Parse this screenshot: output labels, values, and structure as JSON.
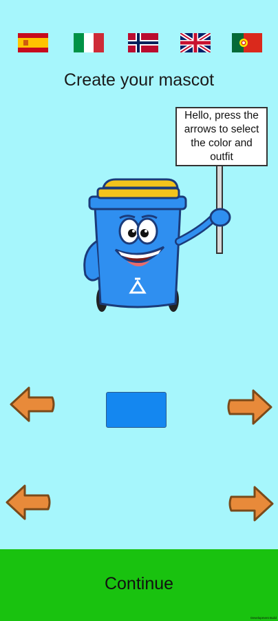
{
  "languages": [
    {
      "name": "Spanish",
      "icon": "spain-flag-icon"
    },
    {
      "name": "Italian",
      "icon": "italy-flag-icon"
    },
    {
      "name": "Norwegian",
      "icon": "norway-flag-icon"
    },
    {
      "name": "English",
      "icon": "uk-flag-icon"
    },
    {
      "name": "Portuguese",
      "icon": "portugal-flag-icon"
    }
  ],
  "title": "Create your mascot",
  "mascot": {
    "sign_text": "Hello, press the arrows to select the color and outfit",
    "body_color": "#2f8ff0",
    "lid_color": "#f3c31c"
  },
  "color_selector": {
    "current_color": "#1487f0",
    "prev_icon": "left-arrow-icon",
    "next_icon": "right-arrow-icon"
  },
  "outfit_selector": {
    "prev_icon": "left-arrow-icon",
    "next_icon": "right-arrow-icon"
  },
  "footer": {
    "continue_label": "Continue",
    "build_label": "Development Build"
  },
  "colors": {
    "background": "#a6f6fc",
    "footer": "#19c20f",
    "arrow": "#e88a3a"
  }
}
